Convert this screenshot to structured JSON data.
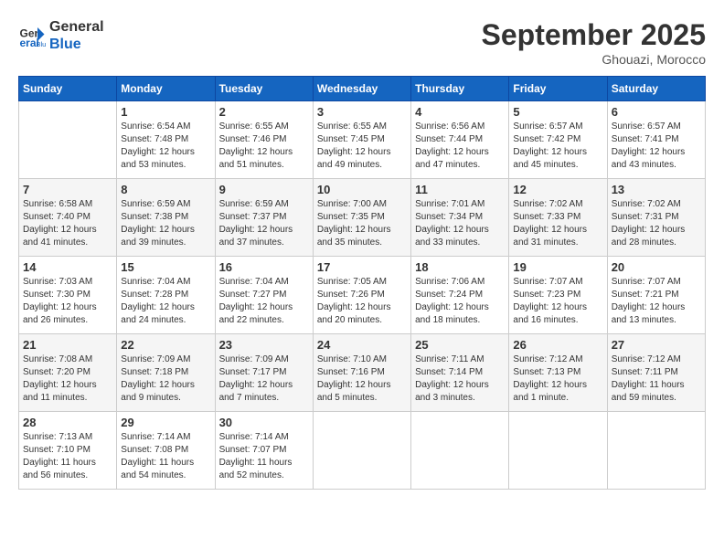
{
  "header": {
    "logo_line1": "General",
    "logo_line2": "Blue",
    "month": "September 2025",
    "location": "Ghouazi, Morocco"
  },
  "weekdays": [
    "Sunday",
    "Monday",
    "Tuesday",
    "Wednesday",
    "Thursday",
    "Friday",
    "Saturday"
  ],
  "weeks": [
    [
      {
        "day": "",
        "info": ""
      },
      {
        "day": "1",
        "info": "Sunrise: 6:54 AM\nSunset: 7:48 PM\nDaylight: 12 hours\nand 53 minutes."
      },
      {
        "day": "2",
        "info": "Sunrise: 6:55 AM\nSunset: 7:46 PM\nDaylight: 12 hours\nand 51 minutes."
      },
      {
        "day": "3",
        "info": "Sunrise: 6:55 AM\nSunset: 7:45 PM\nDaylight: 12 hours\nand 49 minutes."
      },
      {
        "day": "4",
        "info": "Sunrise: 6:56 AM\nSunset: 7:44 PM\nDaylight: 12 hours\nand 47 minutes."
      },
      {
        "day": "5",
        "info": "Sunrise: 6:57 AM\nSunset: 7:42 PM\nDaylight: 12 hours\nand 45 minutes."
      },
      {
        "day": "6",
        "info": "Sunrise: 6:57 AM\nSunset: 7:41 PM\nDaylight: 12 hours\nand 43 minutes."
      }
    ],
    [
      {
        "day": "7",
        "info": "Sunrise: 6:58 AM\nSunset: 7:40 PM\nDaylight: 12 hours\nand 41 minutes."
      },
      {
        "day": "8",
        "info": "Sunrise: 6:59 AM\nSunset: 7:38 PM\nDaylight: 12 hours\nand 39 minutes."
      },
      {
        "day": "9",
        "info": "Sunrise: 6:59 AM\nSunset: 7:37 PM\nDaylight: 12 hours\nand 37 minutes."
      },
      {
        "day": "10",
        "info": "Sunrise: 7:00 AM\nSunset: 7:35 PM\nDaylight: 12 hours\nand 35 minutes."
      },
      {
        "day": "11",
        "info": "Sunrise: 7:01 AM\nSunset: 7:34 PM\nDaylight: 12 hours\nand 33 minutes."
      },
      {
        "day": "12",
        "info": "Sunrise: 7:02 AM\nSunset: 7:33 PM\nDaylight: 12 hours\nand 31 minutes."
      },
      {
        "day": "13",
        "info": "Sunrise: 7:02 AM\nSunset: 7:31 PM\nDaylight: 12 hours\nand 28 minutes."
      }
    ],
    [
      {
        "day": "14",
        "info": "Sunrise: 7:03 AM\nSunset: 7:30 PM\nDaylight: 12 hours\nand 26 minutes."
      },
      {
        "day": "15",
        "info": "Sunrise: 7:04 AM\nSunset: 7:28 PM\nDaylight: 12 hours\nand 24 minutes."
      },
      {
        "day": "16",
        "info": "Sunrise: 7:04 AM\nSunset: 7:27 PM\nDaylight: 12 hours\nand 22 minutes."
      },
      {
        "day": "17",
        "info": "Sunrise: 7:05 AM\nSunset: 7:26 PM\nDaylight: 12 hours\nand 20 minutes."
      },
      {
        "day": "18",
        "info": "Sunrise: 7:06 AM\nSunset: 7:24 PM\nDaylight: 12 hours\nand 18 minutes."
      },
      {
        "day": "19",
        "info": "Sunrise: 7:07 AM\nSunset: 7:23 PM\nDaylight: 12 hours\nand 16 minutes."
      },
      {
        "day": "20",
        "info": "Sunrise: 7:07 AM\nSunset: 7:21 PM\nDaylight: 12 hours\nand 13 minutes."
      }
    ],
    [
      {
        "day": "21",
        "info": "Sunrise: 7:08 AM\nSunset: 7:20 PM\nDaylight: 12 hours\nand 11 minutes."
      },
      {
        "day": "22",
        "info": "Sunrise: 7:09 AM\nSunset: 7:18 PM\nDaylight: 12 hours\nand 9 minutes."
      },
      {
        "day": "23",
        "info": "Sunrise: 7:09 AM\nSunset: 7:17 PM\nDaylight: 12 hours\nand 7 minutes."
      },
      {
        "day": "24",
        "info": "Sunrise: 7:10 AM\nSunset: 7:16 PM\nDaylight: 12 hours\nand 5 minutes."
      },
      {
        "day": "25",
        "info": "Sunrise: 7:11 AM\nSunset: 7:14 PM\nDaylight: 12 hours\nand 3 minutes."
      },
      {
        "day": "26",
        "info": "Sunrise: 7:12 AM\nSunset: 7:13 PM\nDaylight: 12 hours\nand 1 minute."
      },
      {
        "day": "27",
        "info": "Sunrise: 7:12 AM\nSunset: 7:11 PM\nDaylight: 11 hours\nand 59 minutes."
      }
    ],
    [
      {
        "day": "28",
        "info": "Sunrise: 7:13 AM\nSunset: 7:10 PM\nDaylight: 11 hours\nand 56 minutes."
      },
      {
        "day": "29",
        "info": "Sunrise: 7:14 AM\nSunset: 7:08 PM\nDaylight: 11 hours\nand 54 minutes."
      },
      {
        "day": "30",
        "info": "Sunrise: 7:14 AM\nSunset: 7:07 PM\nDaylight: 11 hours\nand 52 minutes."
      },
      {
        "day": "",
        "info": ""
      },
      {
        "day": "",
        "info": ""
      },
      {
        "day": "",
        "info": ""
      },
      {
        "day": "",
        "info": ""
      }
    ]
  ]
}
